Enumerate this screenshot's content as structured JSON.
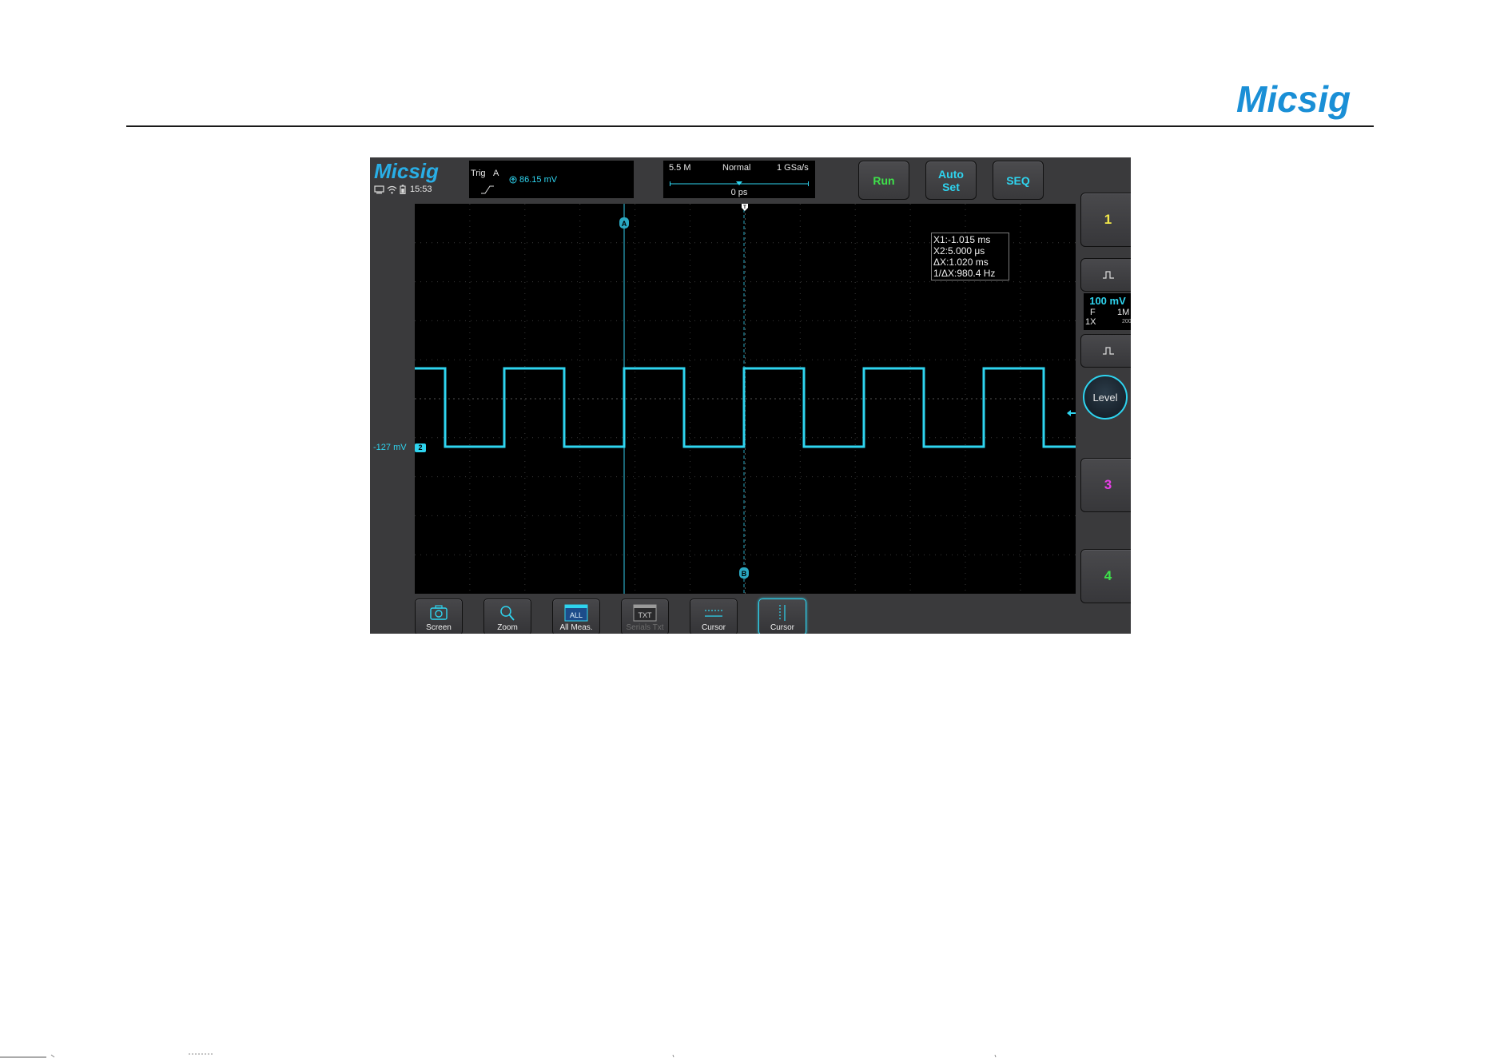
{
  "page": {
    "brand_logo": "Micsig",
    "colors": {
      "brand": "#1a8fd6",
      "rule": "#1a1a1a"
    }
  },
  "scope": {
    "brand_logo": "Micsig",
    "status": {
      "time": "15:53",
      "icons": [
        "monitor-icon",
        "wifi-icon",
        "battery-icon"
      ]
    },
    "trigger": {
      "label": "Trig",
      "source": "A",
      "level": "86.15  mV",
      "slope_icon": "rising-edge-icon"
    },
    "timebase": {
      "memory_depth": "5.5 M",
      "mode": "Normal",
      "sample_rate": "1 GSa/s",
      "delay": "0 ps"
    },
    "buttons": {
      "run": "Run",
      "auto_set": "Auto\nSet",
      "seq": "SEQ"
    },
    "cursor_readout": {
      "x1": "X1:-1.015 ms",
      "x2": "X2:5.000 μs",
      "dx": "ΔX:1.020 ms",
      "inv_dx": "1/ΔX:980.4 Hz"
    },
    "channel_offset": {
      "label": "-127 mV",
      "marker": "2"
    },
    "cursor_markers": {
      "a": "A",
      "b": "B",
      "trigger_point": "T"
    },
    "side": {
      "ch1": "1",
      "ch2": {
        "scale": "100 mV",
        "coupling": "F",
        "impedance": "1M",
        "probe": "1X",
        "bandwidth": "200"
      },
      "level_knob": "Level",
      "ch3": "3",
      "ch4": "4"
    },
    "toolbar": [
      {
        "label": "Screen",
        "icon": "camera-icon"
      },
      {
        "label": "Zoom",
        "icon": "magnifier-icon"
      },
      {
        "label": "All Meas.",
        "icon": "all-meas-icon",
        "icon_text": "ALL"
      },
      {
        "label": "Serials Txt",
        "icon": "serial-text-icon",
        "icon_text": "TXT"
      },
      {
        "label": "Cursor",
        "icon": "horizontal-cursor-icon"
      },
      {
        "label": "Cursor",
        "icon": "vertical-cursor-icon"
      }
    ],
    "waveform": {
      "channel": "2",
      "shape": "square wave",
      "frequency_hz": 980.4,
      "color": "#2ed4ef"
    },
    "colors": {
      "ch1": "#f2e84a",
      "ch2": "#2ed4ef",
      "ch3": "#e63fe6",
      "ch4": "#3ee24a",
      "run": "#3ee24a",
      "panel": "#3a3a3c"
    }
  }
}
